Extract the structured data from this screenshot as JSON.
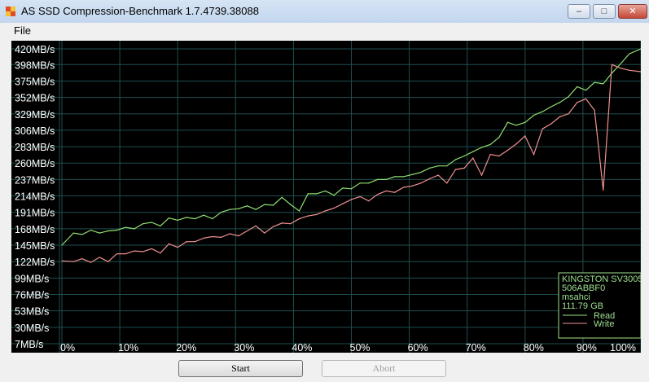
{
  "window": {
    "title": "AS SSD Compression-Benchmark 1.7.4739.38088",
    "min_glyph": "–",
    "max_glyph": "□",
    "close_glyph": "✕"
  },
  "menu": {
    "file": "File"
  },
  "buttons": {
    "start": "Start",
    "abort": "Abort"
  },
  "legend": {
    "drive": "KINGSTON SV3005",
    "firmware": "506ABBF0",
    "driver": "msahci",
    "size": "111.79 GB",
    "read": "Read",
    "write": "Write"
  },
  "colors": {
    "background": "#000000",
    "grid": "#1e4e4e",
    "read": "#90e070",
    "write": "#f09090",
    "text": "#ffffff",
    "legend_text": "#9fe090"
  },
  "chart_data": {
    "type": "line",
    "y_tick_labels": [
      "420MB/s",
      "398MB/s",
      "375MB/s",
      "352MB/s",
      "329MB/s",
      "306MB/s",
      "283MB/s",
      "260MB/s",
      "237MB/s",
      "214MB/s",
      "191MB/s",
      "168MB/s",
      "145MB/s",
      "122MB/s",
      "99MB/s",
      "76MB/s",
      "53MB/s",
      "30MB/s",
      "7MB/s"
    ],
    "y_ticks": [
      420,
      398,
      375,
      352,
      329,
      306,
      283,
      260,
      237,
      214,
      191,
      168,
      145,
      122,
      99,
      76,
      53,
      30,
      7
    ],
    "x_tick_labels": [
      "0%",
      "10%",
      "20%",
      "30%",
      "40%",
      "50%",
      "60%",
      "70%",
      "80%",
      "90%",
      "100%"
    ],
    "ylim": [
      0,
      420
    ],
    "xlim": [
      0,
      100
    ],
    "grid": true,
    "legend_position": "bottom-right",
    "series": [
      {
        "name": "Read",
        "color": "#90e070",
        "x": [
          0,
          2,
          3.5,
          5,
          6.5,
          8,
          9.5,
          11,
          12.5,
          14,
          15.5,
          17,
          18.5,
          20,
          21.5,
          23,
          24.5,
          26,
          27.5,
          29,
          30.5,
          32,
          33.5,
          35,
          36.5,
          38,
          39.5,
          41,
          42.5,
          44,
          45.5,
          47,
          48.5,
          50,
          51.5,
          53,
          54.5,
          56,
          57.5,
          59,
          60.5,
          62,
          63.5,
          65,
          66.5,
          68,
          69.5,
          71,
          72.5,
          74,
          75.5,
          77,
          78.5,
          80,
          81.5,
          83,
          84.5,
          86,
          87.5,
          89,
          90.5,
          92,
          93.5,
          95,
          96.5,
          98,
          100
        ],
        "y": [
          145,
          162,
          160,
          166,
          162,
          165,
          166,
          170,
          168,
          175,
          177,
          172,
          183,
          180,
          184,
          182,
          187,
          182,
          191,
          195,
          196,
          200,
          195,
          202,
          201,
          212,
          202,
          193,
          217,
          217,
          221,
          215,
          225,
          224,
          232,
          232,
          237,
          237,
          241,
          241,
          244,
          247,
          253,
          256,
          256,
          265,
          270,
          276,
          282,
          286,
          296,
          317,
          313,
          317,
          327,
          332,
          339,
          345,
          353,
          367,
          362,
          373,
          371,
          386,
          399,
          413,
          420
        ]
      },
      {
        "name": "Write",
        "color": "#f09090",
        "x": [
          0,
          2,
          3.5,
          5,
          6.5,
          8,
          9.5,
          11,
          12.5,
          14,
          15.5,
          17,
          18.5,
          20,
          21.5,
          23,
          24.5,
          26,
          27.5,
          29,
          30.5,
          32,
          33.5,
          35,
          36.5,
          38,
          39.5,
          41,
          42.5,
          44,
          45.5,
          47,
          48.5,
          50,
          51.5,
          53,
          54.5,
          56,
          57.5,
          59,
          60.5,
          62,
          63.5,
          65,
          66.5,
          68,
          69.5,
          71,
          72.5,
          74,
          75.5,
          77,
          78.5,
          80,
          81.5,
          83,
          84.5,
          86,
          87.5,
          89,
          90.5,
          92,
          93.5,
          95,
          96.5,
          98,
          100
        ],
        "y": [
          123,
          122,
          126,
          121,
          128,
          122,
          133,
          133,
          137,
          136,
          140,
          134,
          147,
          142,
          150,
          150,
          155,
          157,
          156,
          161,
          158,
          165,
          172,
          162,
          171,
          176,
          175,
          182,
          186,
          188,
          193,
          197,
          203,
          209,
          213,
          207,
          216,
          221,
          219,
          226,
          228,
          232,
          238,
          243,
          232,
          251,
          253,
          267,
          243,
          272,
          270,
          278,
          287,
          298,
          272,
          308,
          315,
          325,
          329,
          345,
          350,
          334,
          222,
          398,
          393,
          390,
          388
        ]
      }
    ]
  }
}
